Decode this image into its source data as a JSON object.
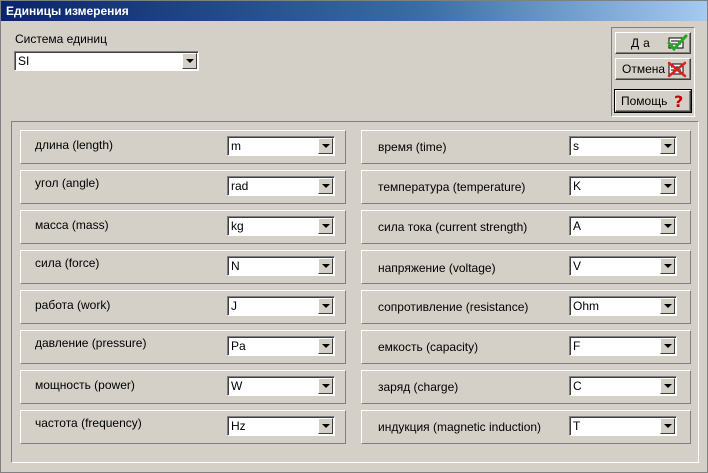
{
  "window": {
    "title": "Единицы измерения"
  },
  "system": {
    "label": "Система единиц",
    "value": "SI"
  },
  "buttons": {
    "ok": "Да",
    "cancel": "Отмена",
    "help": "Помощь"
  },
  "left_rows": [
    {
      "label": "длина (length)",
      "value": "m"
    },
    {
      "label": "угол (angle)",
      "value": "rad"
    },
    {
      "label": "масса (mass)",
      "value": "kg"
    },
    {
      "label": "сила (force)",
      "value": "N"
    },
    {
      "label": "работа (work)",
      "value": "J"
    },
    {
      "label": "давление (pressure)",
      "value": "Pa"
    },
    {
      "label": "мощность (power)",
      "value": "W"
    },
    {
      "label": "частота  (frequency)",
      "value": "Hz"
    }
  ],
  "right_rows": [
    {
      "label": "время (time)",
      "value": "s"
    },
    {
      "label": "температура (temperature)",
      "value": "K"
    },
    {
      "label": "сила тока (current strength)",
      "value": "A"
    },
    {
      "label": "напряжение (voltage)",
      "value": "V"
    },
    {
      "label": "сопротивление (resistance)",
      "value": "Ohm"
    },
    {
      "label": "емкость (capacity)",
      "value": "F"
    },
    {
      "label": "заряд (charge)",
      "value": "C"
    },
    {
      "label": "индукция (magnetic induction)",
      "value": "T"
    }
  ],
  "colors": {
    "titlebar_start": "#0a246a",
    "titlebar_end": "#a6caf0",
    "face": "#d4d0c8",
    "check_green": "#22a822",
    "cross_red": "#e02020",
    "help_red": "#cc0000"
  },
  "icons": {
    "ok": "checkmark-icon",
    "cancel": "cross-icon",
    "help": "question-icon"
  }
}
